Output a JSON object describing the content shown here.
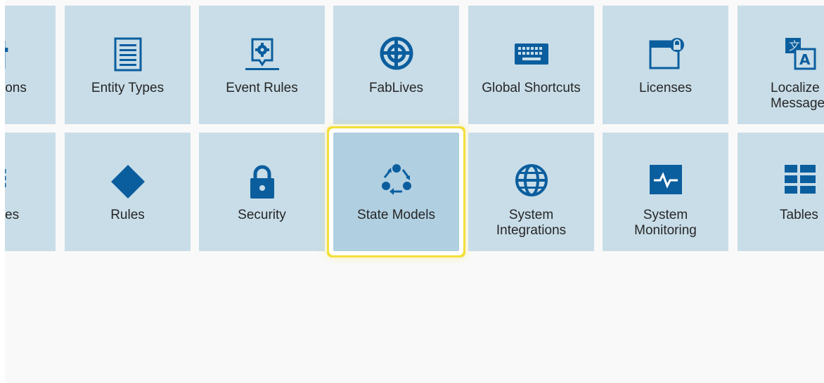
{
  "colors": {
    "tile_bg": "#c8dde8",
    "tile_selected_bg": "#b0cfe1",
    "icon": "#0b5e9e",
    "selection_outline": "#f3df3a",
    "page_bg": "#f9f9f9"
  },
  "row1": [
    {
      "label": "ions",
      "icon": "partial-icon"
    },
    {
      "label": "Entity Types",
      "icon": "document-list-icon"
    },
    {
      "label": "Event Rules",
      "icon": "event-gear-icon"
    },
    {
      "label": "FabLives",
      "icon": "target-icon"
    },
    {
      "label": "Global Shortcuts",
      "icon": "keyboard-icon"
    },
    {
      "label": "Licenses",
      "icon": "window-lock-icon"
    },
    {
      "label": "Localize\nMessage",
      "icon": "translate-icon"
    }
  ],
  "row2": [
    {
      "label": "es",
      "icon": "list-icon"
    },
    {
      "label": "Rules",
      "icon": "diamond-icon"
    },
    {
      "label": "Security",
      "icon": "padlock-icon"
    },
    {
      "label": "State Models",
      "icon": "cycle-icon",
      "selected": true
    },
    {
      "label": "System\nIntegrations",
      "icon": "globe-icon"
    },
    {
      "label": "System\nMonitoring",
      "icon": "heartbeat-monitor-icon"
    },
    {
      "label": "Tables",
      "icon": "table-grid-icon"
    }
  ]
}
